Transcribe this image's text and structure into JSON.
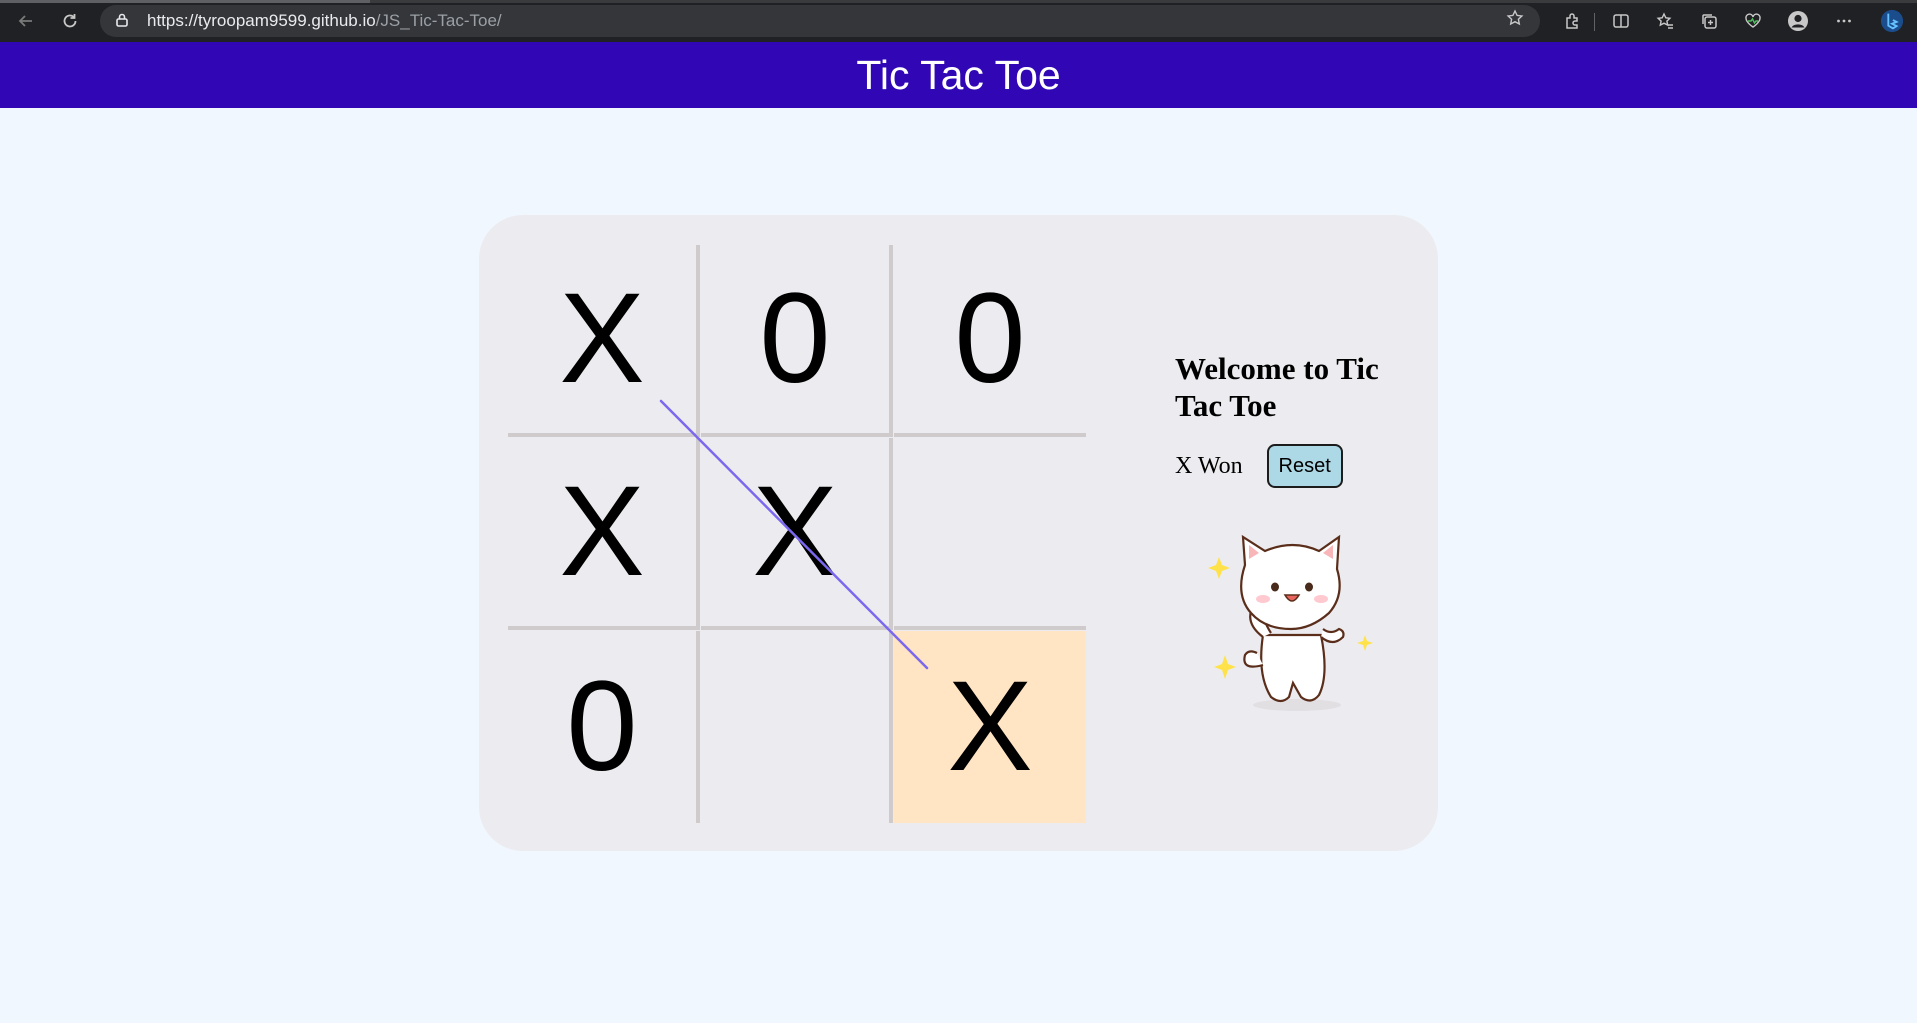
{
  "browser": {
    "url_host": "https://tyroopam9599.github.io",
    "url_path": "/JS_Tic-Tac-Toe/",
    "icons": [
      "back-arrow-icon",
      "reload-icon",
      "lock-icon",
      "favorite-star-icon",
      "extensions-icon",
      "split-screen-icon",
      "favorites-icon",
      "collections-icon",
      "browser-essentials-icon",
      "profile-icon",
      "more-menu-icon",
      "copilot-icon"
    ]
  },
  "header": {
    "title": "Tic Tac Toe",
    "bg_color": "#3107b5"
  },
  "board": {
    "cells": [
      "X",
      "0",
      "0",
      "X",
      "X",
      "",
      "0",
      "",
      "X"
    ],
    "winning_cell_highlight": 8,
    "highlight_color": "#ffe5c4",
    "win_line_color": "#7b68ee"
  },
  "info": {
    "heading": "Welcome to Tic Tac Toe",
    "status": "X Won",
    "reset_label": "Reset"
  }
}
